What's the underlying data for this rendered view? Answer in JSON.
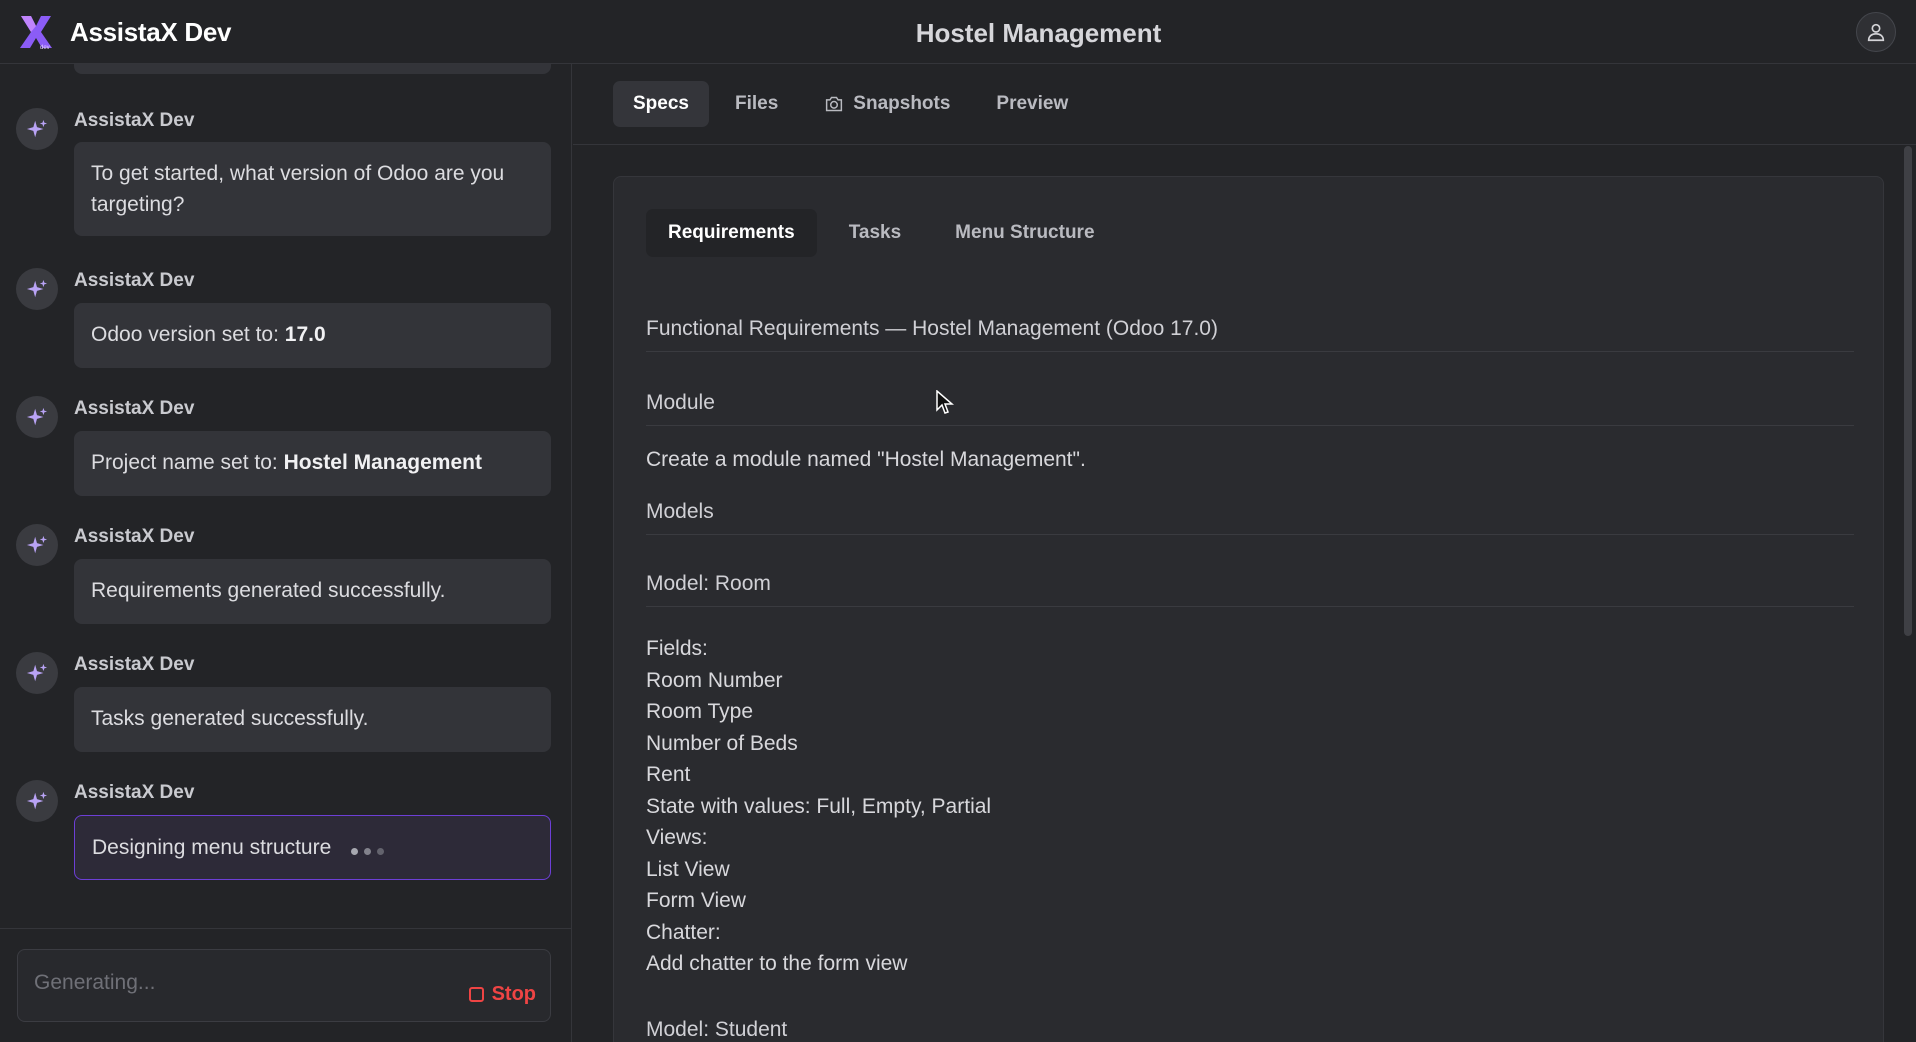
{
  "app": {
    "name": "AssistaX Dev",
    "page_title": "Hostel Management",
    "logo_color": "#8b5cf6"
  },
  "chat": {
    "messages": [
      {
        "sender": "AssistaX Dev",
        "text": "To get started, what version of Odoo are you targeting?"
      },
      {
        "sender": "AssistaX Dev",
        "text_prefix": "Odoo version set to: ",
        "text_bold": "17.0"
      },
      {
        "sender": "AssistaX Dev",
        "text_prefix": "Project name set to: ",
        "text_bold": "Hostel Management"
      },
      {
        "sender": "AssistaX Dev",
        "text": "Requirements generated successfully."
      },
      {
        "sender": "AssistaX Dev",
        "text": "Tasks generated successfully."
      },
      {
        "sender": "AssistaX Dev",
        "text": "Designing menu structure",
        "status": "typing"
      }
    ],
    "composer": {
      "placeholder": "Generating...",
      "stop_label": "Stop"
    }
  },
  "tabs": [
    {
      "label": "Specs",
      "selected": true
    },
    {
      "label": "Files",
      "selected": false
    },
    {
      "label": "Snapshots",
      "selected": false,
      "icon": "camera-icon"
    },
    {
      "label": "Preview",
      "selected": false
    }
  ],
  "subtabs": [
    {
      "label": "Requirements",
      "selected": true
    },
    {
      "label": "Tasks",
      "selected": false
    },
    {
      "label": "Menu Structure",
      "selected": false
    }
  ],
  "spec": {
    "title": "Functional Requirements — Hostel Management (Odoo 17.0)",
    "module_heading": "Module",
    "module_text": "Create a module named \"Hostel Management\".",
    "models_heading": "Models",
    "room_heading": "Model: Room",
    "room_lines": [
      "Fields:",
      "Room Number",
      "Room Type",
      "Number of Beds",
      "Rent",
      "State with values: Full, Empty, Partial",
      "Views:",
      "List View",
      "Form View",
      "Chatter:",
      "Add chatter to the form view"
    ],
    "next_heading": "Model: Student"
  }
}
